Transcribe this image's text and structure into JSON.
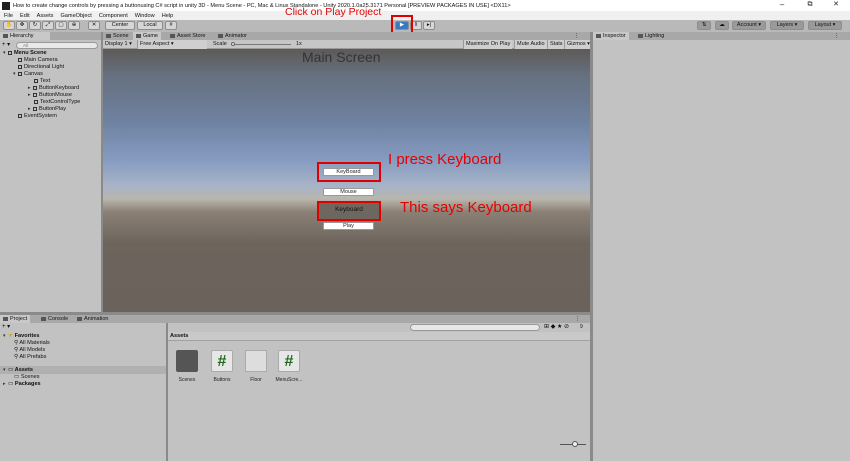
{
  "window": {
    "title": "How to create change controls by pressing a buttonusing C# script in unity 3D - Menu Scene - PC, Mac & Linux Standalone - Unity 2020.1.0a25.3171 Personal [PREVIEW PACKAGES IN USE] <DX11>",
    "minimize": "–",
    "maximize": "⧉",
    "close": "✕"
  },
  "menubar": [
    "File",
    "Edit",
    "Assets",
    "GameObject",
    "Component",
    "Window",
    "Help"
  ],
  "toolbar": {
    "pivot": "Center",
    "space": "Local",
    "account": "Account",
    "layers": "Layers",
    "layout": "Layout",
    "play": "▶",
    "pause": "‖",
    "step": "▸|"
  },
  "annotations": {
    "play": "Click on Play Project",
    "keyboard_press": "I press Keyboard",
    "says": "This says Keyboard"
  },
  "hierarchy": {
    "tab": "Hierarchy",
    "search_placeholder": "All",
    "items": [
      {
        "label": "Menu Scene"
      },
      {
        "label": "Main Camera"
      },
      {
        "label": "Directional Light"
      },
      {
        "label": "Canvas"
      },
      {
        "label": "Text"
      },
      {
        "label": "ButtonKeyboard"
      },
      {
        "label": "ButtonMouse"
      },
      {
        "label": "TextControlType"
      },
      {
        "label": "ButtonPlay"
      },
      {
        "label": "EventSystem"
      }
    ]
  },
  "center_tabs": [
    "Scene",
    "Game",
    "Asset Store",
    "Animator"
  ],
  "game_bar": {
    "display": "Display 1",
    "aspect": "Free Aspect",
    "scale_label": "Scale",
    "scale_value": "1x",
    "maximize": "Maximize On Play",
    "mute": "Mute Audio",
    "stats": "Stats",
    "gizmos": "Gizmos"
  },
  "game": {
    "title": "Main Screen",
    "keyboard_button": "KeyBoard",
    "mouse_button": "Mouse",
    "control_text": "Keyboard",
    "play_button": "Play"
  },
  "right_tabs": [
    "Inspector",
    "Lighting"
  ],
  "bottom_tabs": [
    "Project",
    "Console",
    "Animation"
  ],
  "project": {
    "tree": [
      {
        "label": "Favorites"
      },
      {
        "label": "All Materials"
      },
      {
        "label": "All Models"
      },
      {
        "label": "All Prefabs"
      },
      {
        "label": "Assets"
      },
      {
        "label": "Scenes"
      },
      {
        "label": "Packages"
      }
    ],
    "breadcrumb": "Assets",
    "count": "9",
    "assets": [
      "Scenes",
      "Buttons",
      "Floor",
      "MenuScre..."
    ]
  },
  "colors": {
    "annotation": "#e60000",
    "script_hash": "#1e6b1e",
    "play_active": "#3a78c2"
  }
}
